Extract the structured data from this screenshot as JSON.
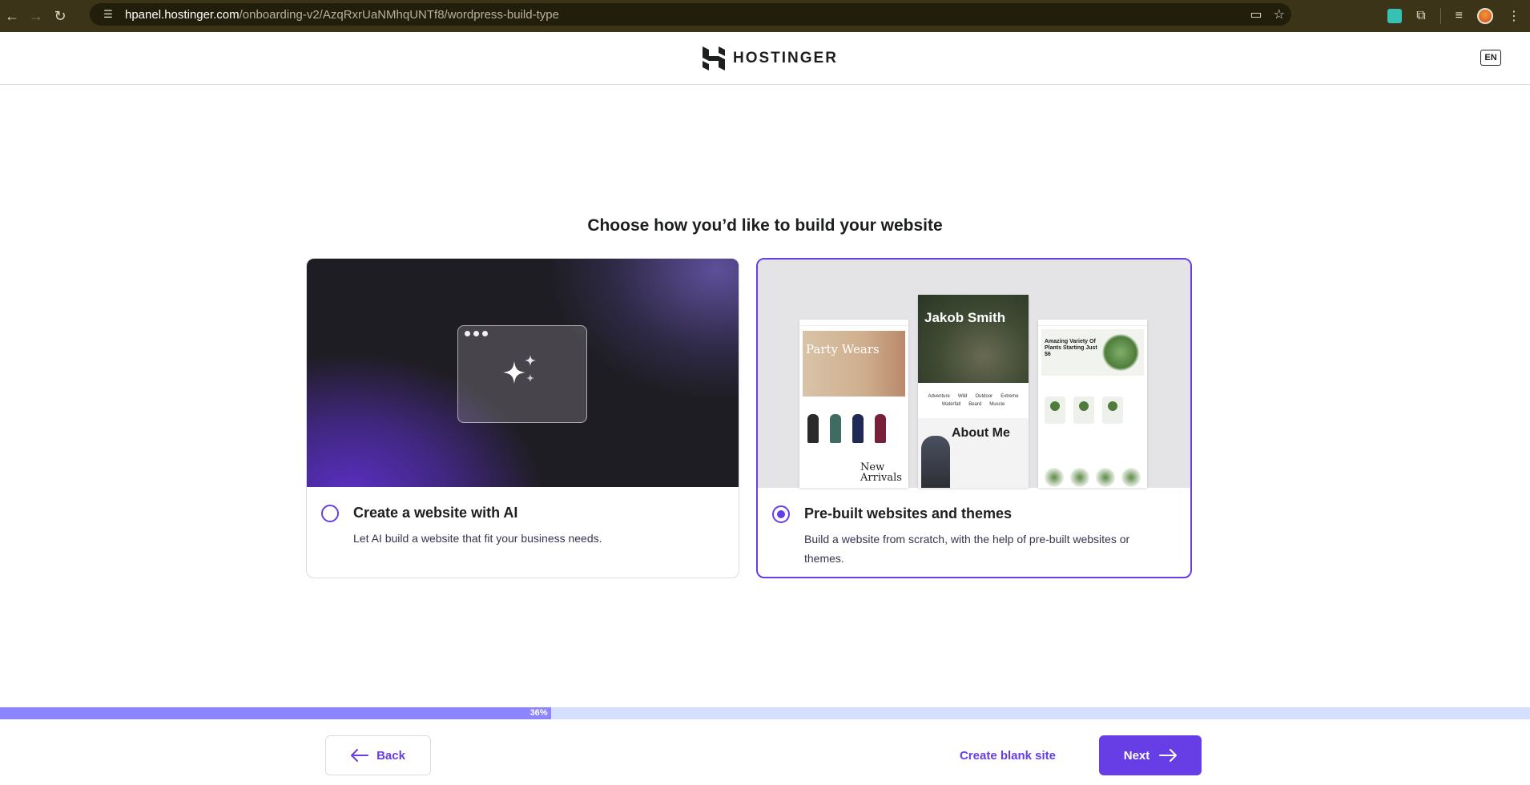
{
  "browser": {
    "url_host": "hpanel.hostinger.com",
    "url_path": "/onboarding-v2/AzqRxrUaNMhqUNTf8/wordpress-build-type"
  },
  "header": {
    "logo_text": "HOSTINGER",
    "language": "EN"
  },
  "page": {
    "title": "Choose how you’d like to build your website"
  },
  "options": [
    {
      "title": "Create a website with AI",
      "description": "Let AI build a website that fit your business needs.",
      "selected": false
    },
    {
      "title": "Pre-built websites and themes",
      "description": "Build a website from scratch, with the help of pre-built websites or themes.",
      "selected": true
    }
  ],
  "preview": {
    "fashion_hero": "Party Wears",
    "fashion_section": "New Arrivals",
    "portfolio_name": "Jakob Smith",
    "portfolio_about": "About Me",
    "portfolio_tags": [
      "Adventure",
      "Wild",
      "Outdoor",
      "Extreme",
      "Waterfall",
      "Beard",
      "Muscle"
    ],
    "plants_hero": "Amazing Variety Of Plants Starting Just $6"
  },
  "progress": {
    "label": "36%",
    "value": 0.36
  },
  "footer": {
    "back_label": "Back",
    "blank_label": "Create blank site",
    "next_label": "Next"
  },
  "colors": {
    "accent": "#673de6",
    "progress_fill": "#8c85ff",
    "progress_track": "#d5dfff"
  }
}
